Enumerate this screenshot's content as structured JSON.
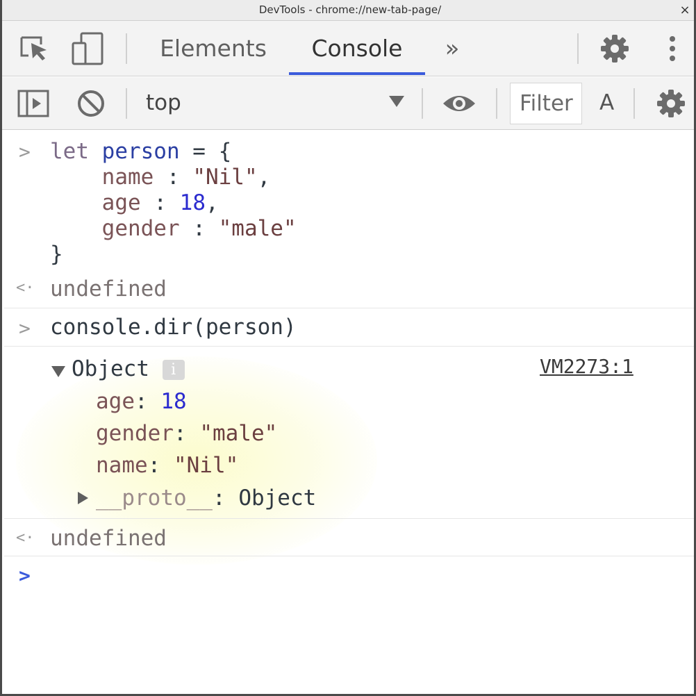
{
  "window": {
    "title": "DevTools - chrome://new-tab-page/",
    "close_glyph": "×"
  },
  "toolbar": {
    "tabs": [
      {
        "label": "Elements",
        "active": false
      },
      {
        "label": "Console",
        "active": true
      }
    ],
    "more_tabs_glyph": "»",
    "icons": [
      "inspect-element-icon",
      "device-toolbar-icon",
      "settings-gear-icon",
      "more-vertical-icon"
    ]
  },
  "console_toolbar": {
    "context": "top",
    "filter_placeholder": "Filter",
    "levels_label": "A",
    "icons": [
      "show-sidebar-icon",
      "clear-console-icon",
      "live-expression-eye-icon",
      "console-settings-gear-icon"
    ]
  },
  "console": {
    "entries": [
      {
        "type": "input",
        "lines": [
          "let person = {",
          "    name : \"Nil\",",
          "    age : 18,",
          "    gender : \"male\"",
          "}"
        ]
      },
      {
        "type": "result",
        "text": "undefined"
      },
      {
        "type": "input",
        "text": "console.dir(person)"
      },
      {
        "type": "object",
        "label": "Object",
        "info_badge": "i",
        "source_link": "VM2273:1",
        "properties": [
          {
            "key": "age",
            "value": "18",
            "kind": "number"
          },
          {
            "key": "gender",
            "value": "\"male\"",
            "kind": "string"
          },
          {
            "key": "name",
            "value": "\"Nil\"",
            "kind": "string"
          }
        ],
        "proto": {
          "key": "__proto__",
          "value": "Object"
        }
      },
      {
        "type": "result",
        "text": "undefined"
      }
    ],
    "prompt_glyph": ">",
    "result_glyph": "<·"
  },
  "colors": {
    "accent": "#3b5bdb",
    "string": "#6b3f40",
    "number": "#2b2bcf",
    "keyword": "#7b6a87",
    "variable": "#2b3fa3"
  }
}
